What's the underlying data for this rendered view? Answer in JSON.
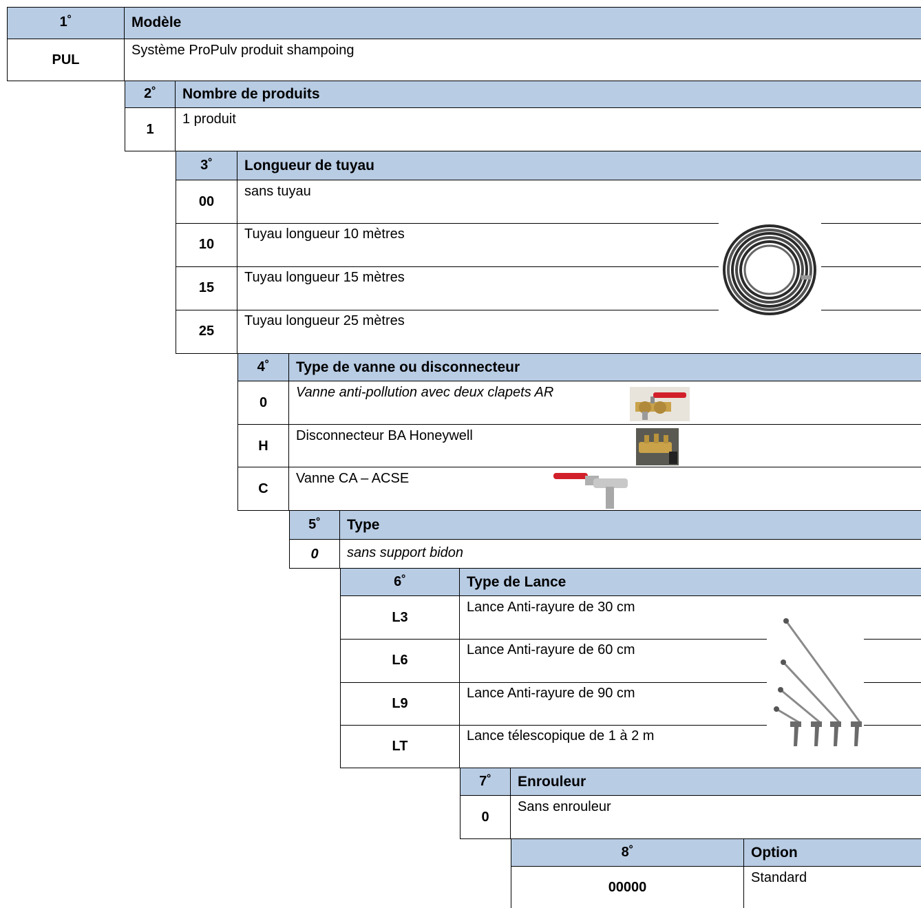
{
  "sections": [
    {
      "num": "1˚",
      "title": "Modèle",
      "options": [
        {
          "code": "PUL",
          "desc": "Système ProPulv produit shampoing"
        }
      ]
    },
    {
      "num": "2˚",
      "title": "Nombre de produits",
      "options": [
        {
          "code": "1",
          "desc": "1 produit"
        }
      ]
    },
    {
      "num": "3˚",
      "title": "Longueur de tuyau",
      "options": [
        {
          "code": "00",
          "desc": "sans tuyau"
        },
        {
          "code": "10",
          "desc": "Tuyau longueur 10 mètres"
        },
        {
          "code": "15",
          "desc": "Tuyau longueur 15 mètres"
        },
        {
          "code": "25",
          "desc": "Tuyau longueur 25 mètres"
        }
      ]
    },
    {
      "num": "4˚",
      "title": "Type de vanne ou disconnecteur",
      "options": [
        {
          "code": "0",
          "desc": "Vanne anti-pollution avec deux clapets AR"
        },
        {
          "code": "H",
          "desc": "Disconnecteur BA  Honeywell"
        },
        {
          "code": "C",
          "desc": "Vanne CA – ACSE"
        }
      ]
    },
    {
      "num": "5˚",
      "title": "Type",
      "options": [
        {
          "code": "0",
          "desc": "sans support bidon"
        }
      ]
    },
    {
      "num": "6˚",
      "title": "Type de Lance",
      "options": [
        {
          "code": "L3",
          "desc": "Lance Anti-rayure de 30 cm"
        },
        {
          "code": "L6",
          "desc": "Lance Anti-rayure de 60 cm"
        },
        {
          "code": "L9",
          "desc": "Lance Anti-rayure de 90 cm"
        },
        {
          "code": "LT",
          "desc": "Lance télescopique de 1 à 2 m"
        }
      ]
    },
    {
      "num": "7˚",
      "title": "Enrouleur",
      "options": [
        {
          "code": "0",
          "desc": "Sans enrouleur"
        }
      ]
    },
    {
      "num": "8˚",
      "title": "Option",
      "options": [
        {
          "code": "00000",
          "desc": "Standard"
        }
      ]
    }
  ],
  "colors": {
    "header_bg": "#b8cce4",
    "border": "#000000"
  },
  "images": [
    "hose-coil-photo",
    "anti-pollution-valve-photo",
    "disconnector-photo",
    "ca-valve-photo",
    "lances-photo"
  ]
}
